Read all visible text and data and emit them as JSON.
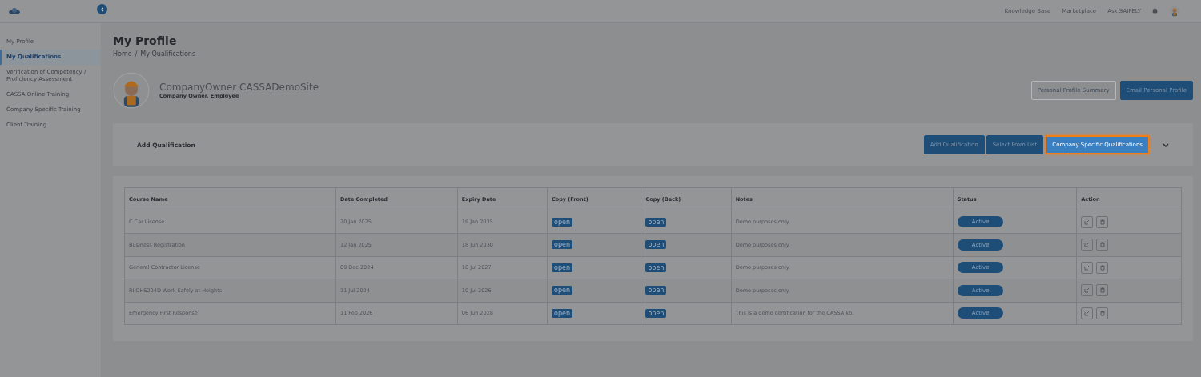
{
  "topnav": {
    "links": [
      "Knowledge Base",
      "Marketplace",
      "Ask SAIFELY"
    ]
  },
  "sidebar": {
    "items": [
      {
        "label": "My Profile",
        "selected": false
      },
      {
        "label": "My Qualifications",
        "selected": true
      },
      {
        "label": "Verification of Competency / Proficiency Assessment",
        "selected": false
      },
      {
        "label": "CASSA Online Training",
        "selected": false
      },
      {
        "label": "Company Specific Training",
        "selected": false
      },
      {
        "label": "Client Training",
        "selected": false
      }
    ]
  },
  "page": {
    "title": "My Profile",
    "breadcrumb": [
      "Home",
      "My Qualifications"
    ],
    "breadcrumb_separator": "/"
  },
  "profile": {
    "name": "CompanyOwner CASSADemoSite",
    "roles": "Company Owner, Employee",
    "buttons": [
      {
        "label": "Personal Profile Summary",
        "kind": "outline"
      },
      {
        "label": "Email Personal Profile",
        "kind": "solid"
      }
    ]
  },
  "qualification_bar": {
    "title": "Add Qualification",
    "buttons": [
      {
        "label": "Add Qualification",
        "highlighted": false
      },
      {
        "label": "Select From List",
        "highlighted": false
      },
      {
        "label": "Company Specific Qualifications",
        "highlighted": true
      }
    ]
  },
  "table": {
    "columns": [
      "Course Name",
      "Date Completed",
      "Expiry Date",
      "Copy (Front)",
      "Copy (Back)",
      "Notes",
      "Status",
      "Action"
    ],
    "rows": [
      {
        "course": "C Car License",
        "completed": "20 Jan 2025",
        "expiry": "19 Jan 2035",
        "front": "open",
        "back": "open",
        "notes": "Demo purposes only.",
        "status": "Active"
      },
      {
        "course": "Business Registration",
        "completed": "12 Jan 2025",
        "expiry": "18 Jun 2030",
        "front": "open",
        "back": "open",
        "notes": "Demo purposes only.",
        "status": "Active"
      },
      {
        "course": "General Contractor License",
        "completed": "09 Dec 2024",
        "expiry": "18 Jul 2027",
        "front": "open",
        "back": "open",
        "notes": "Demo purposes only.",
        "status": "Active"
      },
      {
        "course": "RIIOHS204D Work Safely at Heights",
        "completed": "11 Jul 2024",
        "expiry": "10 Jul 2026",
        "front": "open",
        "back": "open",
        "notes": "Demo purposes only.",
        "status": "Active"
      },
      {
        "course": "Emergency First Response",
        "completed": "11 Feb 2026",
        "expiry": "06 Jun 2028",
        "front": "open",
        "back": "open",
        "notes": "This is a demo certification for the CASSA kb.",
        "status": "Active"
      }
    ]
  }
}
